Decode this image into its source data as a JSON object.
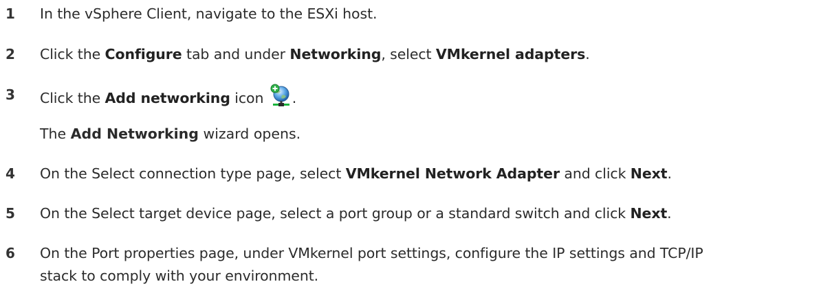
{
  "steps": [
    {
      "number": "1",
      "parts": [
        {
          "t": "In the vSphere Client, navigate to the ESXi host."
        }
      ]
    },
    {
      "number": "2",
      "parts": [
        {
          "t": "Click the "
        },
        {
          "t": "Configure",
          "b": true
        },
        {
          "t": " tab and under "
        },
        {
          "t": "Networking",
          "b": true
        },
        {
          "t": ", select "
        },
        {
          "t": "VMkernel adapters",
          "b": true
        },
        {
          "t": "."
        }
      ]
    },
    {
      "number": "3",
      "parts": [
        {
          "t": "Click the "
        },
        {
          "t": "Add networking",
          "b": true
        },
        {
          "t": " icon "
        },
        {
          "icon": "add-networking-icon"
        },
        {
          "t": "."
        }
      ],
      "result": [
        {
          "t": "The "
        },
        {
          "t": "Add Networking",
          "b": true
        },
        {
          "t": " wizard opens."
        }
      ]
    },
    {
      "number": "4",
      "parts": [
        {
          "t": "On the Select connection type page, select "
        },
        {
          "t": "VMkernel Network Adapter",
          "b": true
        },
        {
          "t": " and click "
        },
        {
          "t": "Next",
          "b": true
        },
        {
          "t": "."
        }
      ]
    },
    {
      "number": "5",
      "parts": [
        {
          "t": "On the Select target device page, select a port group or a standard switch and click "
        },
        {
          "t": "Next",
          "b": true
        },
        {
          "t": "."
        }
      ]
    },
    {
      "number": "6",
      "parts": [
        {
          "t": "On the Port properties page, under VMkernel port settings, configure the IP settings and TCP/IP stack to comply with your environment."
        }
      ]
    }
  ]
}
